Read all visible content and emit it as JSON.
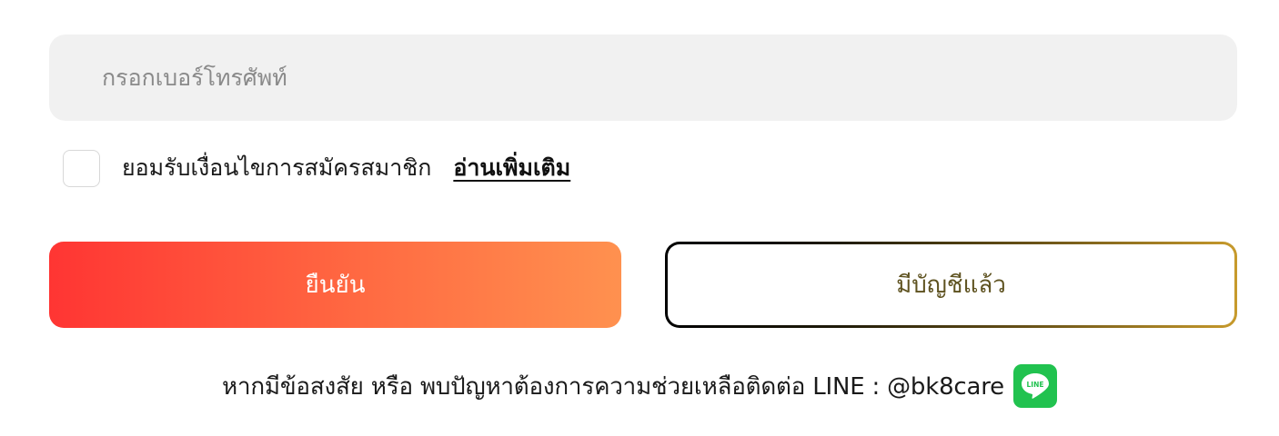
{
  "form": {
    "phone_placeholder": "กรอกเบอร์โทรศัพท์",
    "terms_label": "ยอมรับเงื่อนไขการสมัครสมาชิก",
    "terms_link": "อ่านเพิ่มเติม",
    "terms_checked": false
  },
  "buttons": {
    "confirm": "ยืนยัน",
    "have_account": "มีบัญชีแล้ว"
  },
  "help": {
    "text": "หากมีข้อสงสัย หรือ พบปัญหาต้องการความช่วยเหลือติดต่อ LINE : @bk8care",
    "line_icon_text": "LINE"
  },
  "colors": {
    "confirm_gradient": [
      "#ff3533",
      "#ff914f"
    ],
    "account_border_gradient": [
      "#000000",
      "#c79a2c"
    ],
    "account_text": "#5e5220",
    "line_green": "#21c24f",
    "field_bg": "#f1f1f1"
  }
}
